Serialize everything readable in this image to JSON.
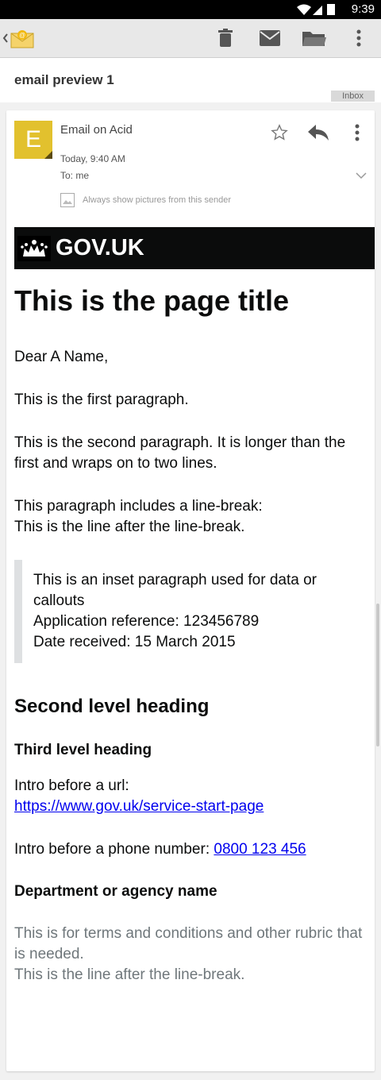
{
  "statusbar": {
    "time": "9:39"
  },
  "toolbar": {
    "back_icon": "back-chevron-icon",
    "app_icon": "mail-app-icon",
    "actions": [
      "delete-icon",
      "mark-unread-icon",
      "move-folder-icon",
      "overflow-menu-icon"
    ]
  },
  "subject": "email preview 1",
  "label": "Inbox",
  "message": {
    "avatar_letter": "E",
    "sender": "Email on Acid",
    "date": "Today, 9:40 AM",
    "to": "To: me",
    "show_pictures": "Always show pictures from this sender"
  },
  "email": {
    "brand": "GOV.UK",
    "title": "This is the page title",
    "greeting": "Dear A Name,",
    "p1": "This is the first paragraph.",
    "p2": "This is the second paragraph. It is longer than the first and wraps on to two lines.",
    "p3_line1": "This paragraph includes a line-break:",
    "p3_line2": "This is the line after the line-break.",
    "inset_line1": "This is an inset paragraph used for data or callouts",
    "inset_line2": "Application reference: 123456789",
    "inset_line3": "Date received: 15 March 2015",
    "h2": "Second level heading",
    "h3": "Third level heading",
    "url_intro": "Intro before a url:",
    "url": "https://www.gov.uk/service-start-page",
    "phone_intro": "Intro before a phone number: ",
    "phone": "0800 123 456",
    "dept": "Department or agency name",
    "rubric_line1": "This is for terms and conditions and other rubric that is needed.",
    "rubric_line2": "This is the line after the line-break."
  },
  "colors": {
    "avatar": "#e2c12e",
    "govbar": "#0b0c0c",
    "link": "#0000ee"
  }
}
